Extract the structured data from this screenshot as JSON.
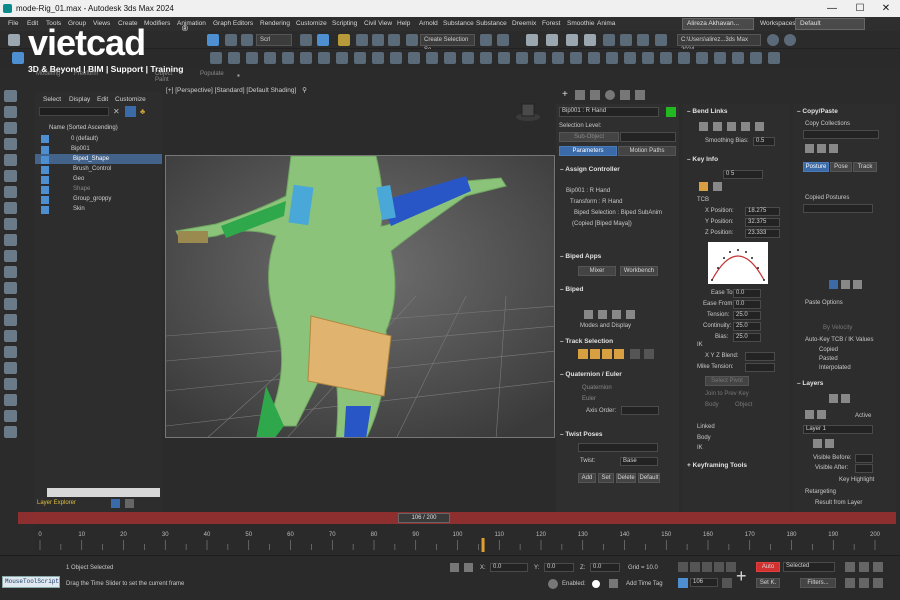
{
  "window": {
    "title": "mode-Rig_01.max - Autodesk 3ds Max 2024",
    "minimize": "—",
    "maximize": "☐",
    "close": "✕"
  },
  "menu": {
    "items": [
      "File",
      "Edit",
      "Tools",
      "Group",
      "Views",
      "Create",
      "Modifiers",
      "Animation",
      "Graph Editors",
      "Rendering",
      "Customize",
      "Scripting",
      "Civil View",
      "Help",
      "Arnold",
      "Substance",
      "Substance",
      "Dreemix",
      "Forest",
      "Smoothie",
      "Anima"
    ],
    "user": "Alireza Akhavan...",
    "workspace_label": "Workspaces:",
    "workspace_value": "Default"
  },
  "toolbar": {
    "view_drop": "Scrl",
    "create_selection": "Create Selection Se",
    "path_drop": "C:\\Users\\alirez...3ds Max 2024"
  },
  "watermark": {
    "logo": "vietcad",
    "tagline": "3D & Beyond | BIM | Support | Training"
  },
  "ribbon_tabs": [
    "Modeling",
    "Freeform",
    "Object Paint",
    "Populate"
  ],
  "scene_explorer": {
    "tabs": [
      "Select",
      "Display",
      "Edit",
      "Customize"
    ],
    "header": "Name (Sorted Ascending)",
    "rows": [
      {
        "label": "0 (default)",
        "selected": false
      },
      {
        "label": "Bip001",
        "selected": false
      },
      {
        "label": "Biped_Shape",
        "selected": true
      },
      {
        "label": "Brush_Control",
        "selected": false
      },
      {
        "label": "Geo",
        "selected": false
      },
      {
        "label": "Shape",
        "selected": false
      },
      {
        "label": "Group_groppy",
        "selected": false
      },
      {
        "label": "Skin",
        "selected": false
      }
    ],
    "bottom_label": "Layer Explorer"
  },
  "viewport": {
    "label": "[+] [Perspective] [Standard] [Default Shading]"
  },
  "motion_panel": {
    "object_name": "Bip001 : R Hand",
    "selection_level": "Selection Level:",
    "sub_object": "Sub-Object",
    "tabs": [
      "Parameters",
      "Motion Paths"
    ],
    "assign_controller": "Assign Controller",
    "tree": [
      "Bip001 : R Hand",
      "Transform : R Hand",
      "Biped Selection : Biped SubAnim",
      "(Copied [Biped Maya])"
    ],
    "biped_apps": "Biped Apps",
    "apps_buttons": [
      "Mixer",
      "Workbench"
    ],
    "biped": "Biped",
    "modes_display": "Modes and Display",
    "track_selection": "Track Selection",
    "quaternion": "Quaternion / Euler",
    "quaternion_opt": "Quaternion",
    "euler_opt": "Euler",
    "axis_order": "Axis Order:",
    "twist_poses": "Twist Poses",
    "twist_label": "Twist:",
    "twist_value": "Base",
    "twist_buttons": [
      "Add",
      "Set",
      "Delete",
      "Default"
    ]
  },
  "bend_links": {
    "title": "Bend Links",
    "smoothing_label": "Smoothing Bias:",
    "smoothing_value": "0.5",
    "key_info": "Key Info",
    "key_field": "0 5",
    "tcb": "TCB",
    "x_label": "X Position:",
    "x_value": "18.275",
    "y_label": "Y Position:",
    "y_value": "32.375",
    "z_label": "Z Position:",
    "z_value": "23.333",
    "ease_to_label": "Ease To:",
    "ease_to": "0.0",
    "ease_from_label": "Ease From:",
    "ease_from": "0.0",
    "tension_label": "Tension:",
    "tension": "25.0",
    "continuity_label": "Continuity:",
    "continuity": "25.0",
    "bias_label": "Bias:",
    "bias": "25.0",
    "ik_label": "IK",
    "xyz_blend": "X Y Z Blend:",
    "mike_tension": "Mike Tension:",
    "select_pivot": "Select Pivot",
    "join_to_prev": "Join to Prev Key",
    "body": "Body",
    "object": "Object",
    "linked": "Linked",
    "body2": "Body",
    "ik2": "IK",
    "keyframing_tools": "Keyframing Tools"
  },
  "copy_paste": {
    "title": "Copy/Paste",
    "copy_collections": "Copy Collections",
    "tabs": [
      "Posture",
      "Pose",
      "Track"
    ],
    "copied_postures": "Copied Postures",
    "paste_options": "Paste Options",
    "by_velocity": "By Velocity",
    "auto_key": "Auto-Key TCB / IK Values",
    "copied": "Copied",
    "pasted": "Pasted",
    "interpolated": "Interpolated",
    "layers": "Layers",
    "active": "Active",
    "layer_name": "Layer 1",
    "visible_before": "Visible Before:",
    "visible_after": "Visible After:",
    "key_highlight": "Key Highlight",
    "retargeting": "Retargeting",
    "result_from_layer": "Result from Layer"
  },
  "timeslider": {
    "frame_label": "106 / 200",
    "ticks": [
      "0",
      "10",
      "20",
      "30",
      "40",
      "50",
      "60",
      "70",
      "80",
      "90",
      "100",
      "110",
      "120",
      "130",
      "140",
      "150",
      "160",
      "170",
      "180",
      "190",
      "200"
    ]
  },
  "statusbar": {
    "script_label": "MouseToolScript",
    "selection": "1 Object Selected",
    "hint": "Drag the Time Slider to set the current frame",
    "x_label": "X:",
    "x_value": "0.0",
    "y_label": "Y:",
    "y_value": "0.0",
    "z_label": "Z:",
    "z_value": "0.0",
    "grid": "Grid = 10.0",
    "enabled": "Enabled:",
    "add_time_tag": "Add Time Tag",
    "frame": "106",
    "auto": "Auto",
    "selected": "Selected",
    "set_k": "Set K.",
    "filters": "Filters..."
  },
  "colors": {
    "accent": "#4d8fd0",
    "timebar": "#8e2f2f",
    "character": "#8bc37a",
    "biped_blue": "#2856c6",
    "biped_green": "#2ea84a",
    "box": "#e0b46e"
  }
}
